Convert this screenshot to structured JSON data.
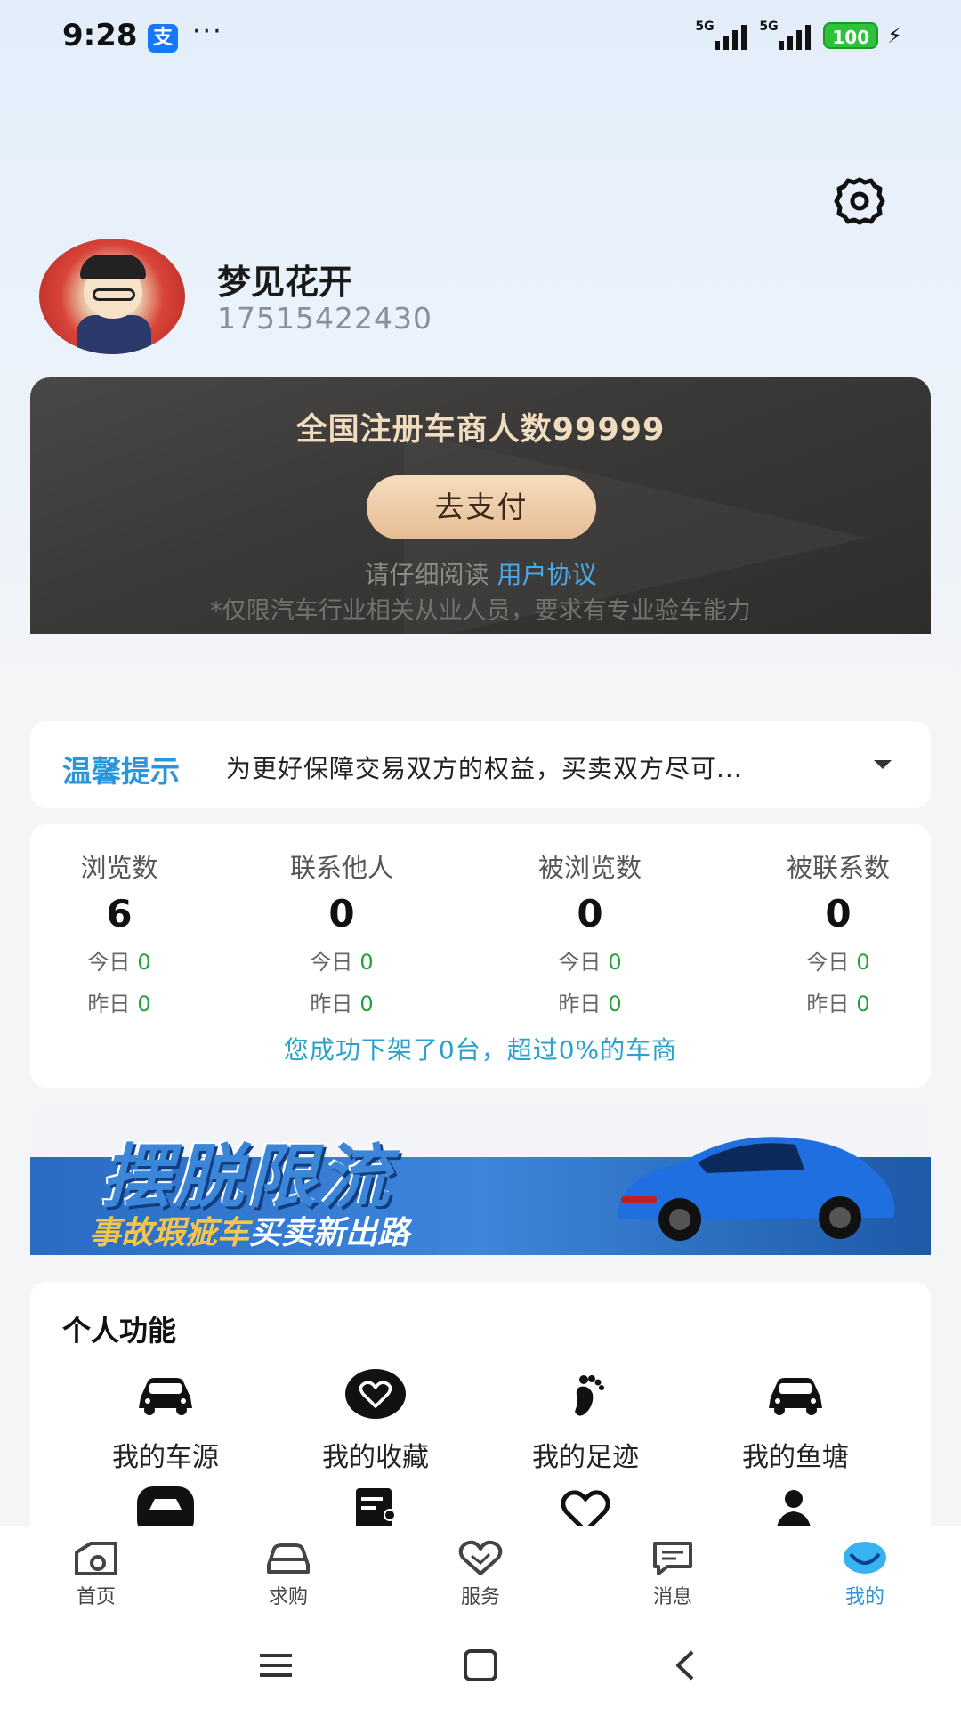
{
  "status_bar": {
    "time": "9:28",
    "alipay_glyph": "支",
    "dots": "···",
    "signal1": "5G",
    "signal2": "5G",
    "battery": "100"
  },
  "profile": {
    "username": "梦见花开",
    "phone": "17515422430"
  },
  "promo": {
    "title": "全国注册车商人数99999",
    "pay_button": "去支付",
    "agree_prefix": "请仔细阅读",
    "agree_link": "用户协议",
    "disclaimer": "*仅限汽车行业相关从业人员，要求有专业验车能力"
  },
  "tip": {
    "label": "温馨提示",
    "text": "为更好保障交易双方的权益，买卖双方尽可..."
  },
  "stats": {
    "today_label": "今日",
    "yesterday_label": "昨日",
    "items": [
      {
        "label": "浏览数",
        "value": "6",
        "today": "0",
        "yesterday": "0"
      },
      {
        "label": "联系他人",
        "value": "0",
        "today": "0",
        "yesterday": "0"
      },
      {
        "label": "被浏览数",
        "value": "0",
        "today": "0",
        "yesterday": "0"
      },
      {
        "label": "被联系数",
        "value": "0",
        "today": "0",
        "yesterday": "0"
      }
    ],
    "footer": "您成功下架了0台，超过0%的车商"
  },
  "banner": {
    "title": "摆脱限流",
    "sub_highlight": "事故瑕疵车",
    "sub_rest": "买卖新出路"
  },
  "functions": {
    "title": "个人功能",
    "items": [
      {
        "label": "我的车源",
        "icon": "car-icon"
      },
      {
        "label": "我的收藏",
        "icon": "heart-icon"
      },
      {
        "label": "我的足迹",
        "icon": "footprint-icon"
      },
      {
        "label": "我的鱼塘",
        "icon": "car-icon"
      }
    ]
  },
  "tabs": [
    {
      "label": "首页",
      "icon": "home-icon"
    },
    {
      "label": "求购",
      "icon": "car-outline-icon"
    },
    {
      "label": "服务",
      "icon": "handshake-heart-icon"
    },
    {
      "label": "消息",
      "icon": "message-icon"
    },
    {
      "label": "我的",
      "icon": "profile-icon",
      "active": true
    }
  ],
  "colors": {
    "accent": "#2a95d8",
    "promo_gold": "#f1dcbf",
    "green": "#22a33a"
  }
}
